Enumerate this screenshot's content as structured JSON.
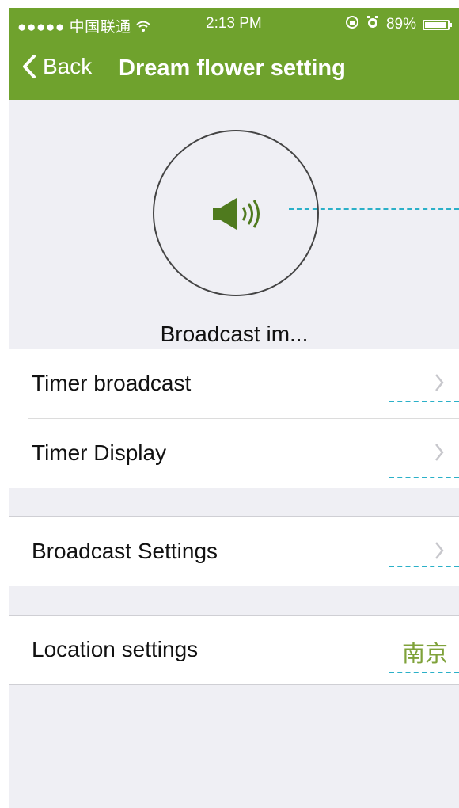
{
  "status_bar": {
    "carrier": "●●●●● 中国联通",
    "time": "2:13 PM",
    "battery_text": "89%",
    "battery_level": 0.89
  },
  "nav": {
    "back_label": "Back",
    "title": "Dream flower setting"
  },
  "broadcast": {
    "caption": "Broadcast im..."
  },
  "groups": [
    {
      "rows": [
        {
          "label": "Timer broadcast"
        },
        {
          "label": "Timer Display"
        }
      ]
    },
    {
      "rows": [
        {
          "label": "Broadcast Settings"
        }
      ]
    },
    {
      "rows": [
        {
          "label": "Location settings",
          "value": "南京"
        }
      ]
    }
  ],
  "colors": {
    "nav_bar": "#6fa22d",
    "accent_value": "#7fa23a",
    "annotation_line": "#2bb0c8"
  }
}
